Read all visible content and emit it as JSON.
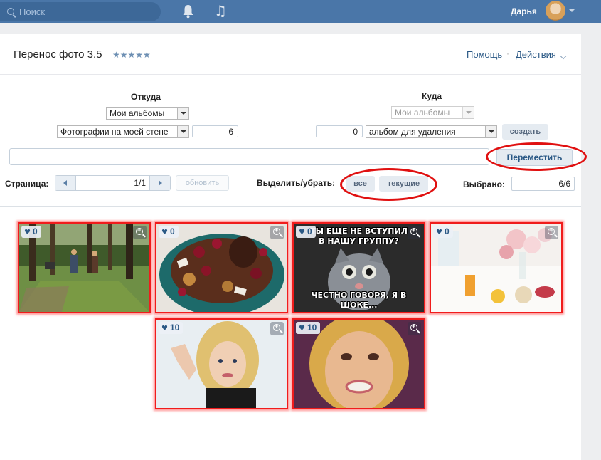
{
  "topbar": {
    "search_placeholder": "Поиск",
    "username": "Дарья",
    "icons": [
      "search-icon",
      "bell-icon",
      "music-note-icon",
      "chevron-down-icon"
    ]
  },
  "app": {
    "title": "Перенос фото 3.5",
    "stars": "★★★★★",
    "help": "Помощь",
    "separator": "·",
    "actions": "Действия"
  },
  "source": {
    "heading": "Откуда",
    "album_select": "Мои альбомы",
    "subalbum_select": "Фотографии на моей стене",
    "count": "6"
  },
  "target": {
    "heading": "Куда",
    "album_select": "Мои альбомы",
    "count": "0",
    "subalbum_select": "альбом для удаления",
    "create_label": "создать"
  },
  "move_button": "Переместить",
  "paging": {
    "label": "Страница:",
    "value": "1/1",
    "refresh_label": "обновить"
  },
  "selection": {
    "label": "Выделить/убрать:",
    "all_label": "все",
    "current_label": "текущие",
    "selected_label": "Выбрано:",
    "selected_value": "6/6"
  },
  "photos": [
    {
      "likes": "0",
      "subject": "forest-walk"
    },
    {
      "likes": "0",
      "subject": "chocolate-cake"
    },
    {
      "likes": "0",
      "subject": "cat-meme",
      "caption_top": "ТЫ ЕЩЕ НЕ ВСТУПИЛ\nВ НАШУ ГРУППУ?",
      "caption_bottom": "ЧЕСТНО ГОВОРЯ, Я В ШОКЕ..."
    },
    {
      "likes": "0",
      "subject": "breakfast-flowers"
    },
    {
      "likes": "10",
      "subject": "portrait-waving"
    },
    {
      "likes": "10",
      "subject": "portrait-closeup"
    }
  ],
  "colors": {
    "header_bg": "#4a76a8",
    "link": "#2a5885",
    "highlight_red": "#e01010"
  }
}
